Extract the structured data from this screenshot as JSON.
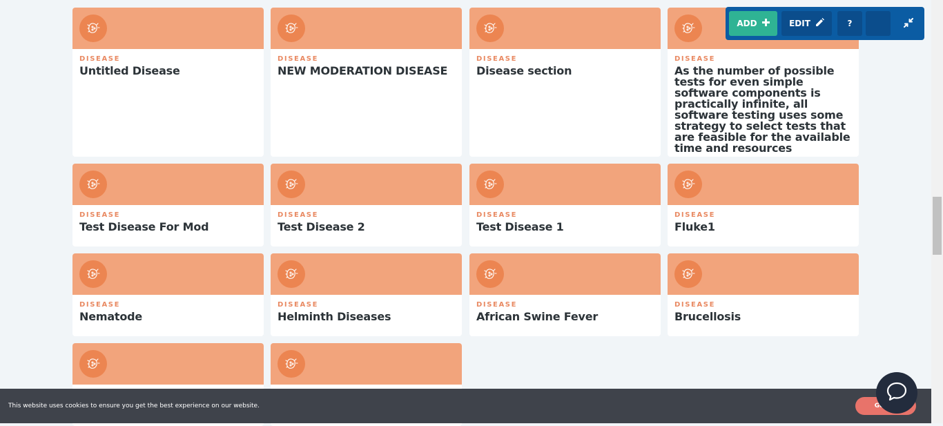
{
  "cards": [
    {
      "type": "DISEASE",
      "title": "Untitled Disease",
      "icon": "bacteria-icon"
    },
    {
      "type": "DISEASE",
      "title": "NEW MODERATION DISEASE",
      "icon": "bacteria-icon"
    },
    {
      "type": "DISEASE",
      "title": "Disease section",
      "icon": "bacteria-icon"
    },
    {
      "type": "DISEASE",
      "title": "As the number of possible tests for even simple software components is practically infinite, all software testing uses some strategy to select tests that are feasible for the available time and resources",
      "icon": "bacteria-icon"
    },
    {
      "type": "DISEASE",
      "title": "Test Disease For Mod",
      "icon": "bacteria-icon"
    },
    {
      "type": "DISEASE",
      "title": "Test Disease 2",
      "icon": "bacteria-icon"
    },
    {
      "type": "DISEASE",
      "title": "Test Disease 1",
      "icon": "bacteria-icon"
    },
    {
      "type": "DISEASE",
      "title": "Fluke1",
      "icon": "bacteria-icon"
    },
    {
      "type": "DISEASE",
      "title": "Nematode",
      "icon": "bacteria-icon"
    },
    {
      "type": "DISEASE",
      "title": "Helminth Diseases",
      "icon": "bacteria-icon"
    },
    {
      "type": "DISEASE",
      "title": "African Swine Fever",
      "icon": "bacteria-icon"
    },
    {
      "type": "DISEASE",
      "title": "Brucellosis",
      "icon": "bacteria-icon"
    },
    {
      "type": "",
      "title": "",
      "icon": "bacteria-icon"
    },
    {
      "type": "",
      "title": "",
      "icon": "bacteria-icon"
    }
  ],
  "toolbar": {
    "add_label": "ADD",
    "edit_label": "EDIT",
    "help_label": "?"
  },
  "cookie": {
    "message": "This website uses cookies to ensure you get the best experience on our website.",
    "button_label": "Got it!"
  },
  "colors": {
    "card_header": "#f2a47c",
    "card_icon_bg": "#ec8551",
    "toolbar_bg": "#0b5ca3",
    "add_button": "#2fb394",
    "cookie_button": "#e8736a"
  }
}
